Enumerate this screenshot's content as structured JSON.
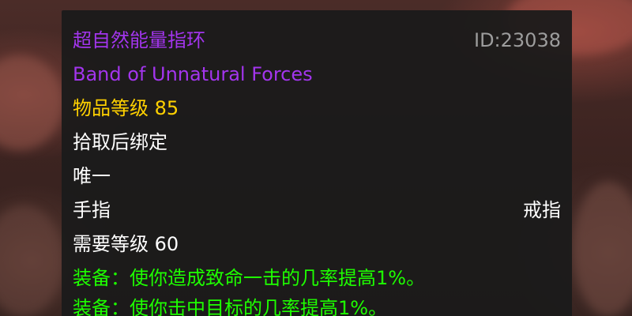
{
  "colors": {
    "epic_purple": "#a335ee",
    "item_level_gold": "#ffd100",
    "white": "#ffffff",
    "id_grey": "#9d9d9d",
    "equip_green": "#1eff00",
    "tooltip_background": "#1b1b1b"
  },
  "item": {
    "name_cn": "超自然能量指环",
    "item_id": "ID:23038",
    "name_en": "Band of Unnatural Forces",
    "item_level": "物品等级 85",
    "bind": "拾取后绑定",
    "unique": "唯一",
    "slot_left": "手指",
    "slot_right": "戒指",
    "required_level": "需要等级 60",
    "effects": [
      "装备：使你造成致命一击的几率提高1%。",
      "装备：使你击中目标的几率提高1%。"
    ]
  }
}
